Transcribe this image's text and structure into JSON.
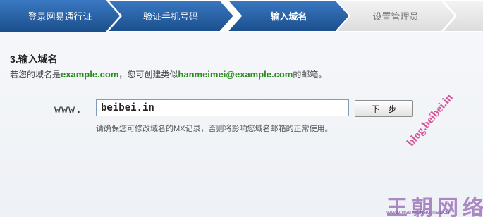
{
  "steps": [
    {
      "label": "登录网易通行证",
      "state": "done"
    },
    {
      "label": "验证手机号码",
      "state": "done"
    },
    {
      "label": "输入域名",
      "state": "current"
    },
    {
      "label": "设置管理员",
      "state": "todo"
    },
    {
      "label": "",
      "state": "todo"
    }
  ],
  "section": {
    "title": "3.输入域名",
    "hint_prefix": "若您的域名是",
    "hint_domain": "example.com",
    "hint_middle": "，您可创建类似",
    "hint_email": "hanmeimei@example.com",
    "hint_suffix": "的邮箱。"
  },
  "form": {
    "prefix": "www.",
    "domain_value": "beibei.in",
    "next_label": "下一步",
    "note": "请确保您可修改域名的MX记录，否则将影响您域名邮箱的正常使用。"
  },
  "watermark": {
    "diagonal": "blog.beibei.in",
    "big": "王朝网络",
    "url": "www.wangchao.net.cn"
  },
  "colors": {
    "step_active": "#1f5a9c",
    "step_inactive": "#e6e6e6",
    "green_text": "#2c8a1f"
  }
}
